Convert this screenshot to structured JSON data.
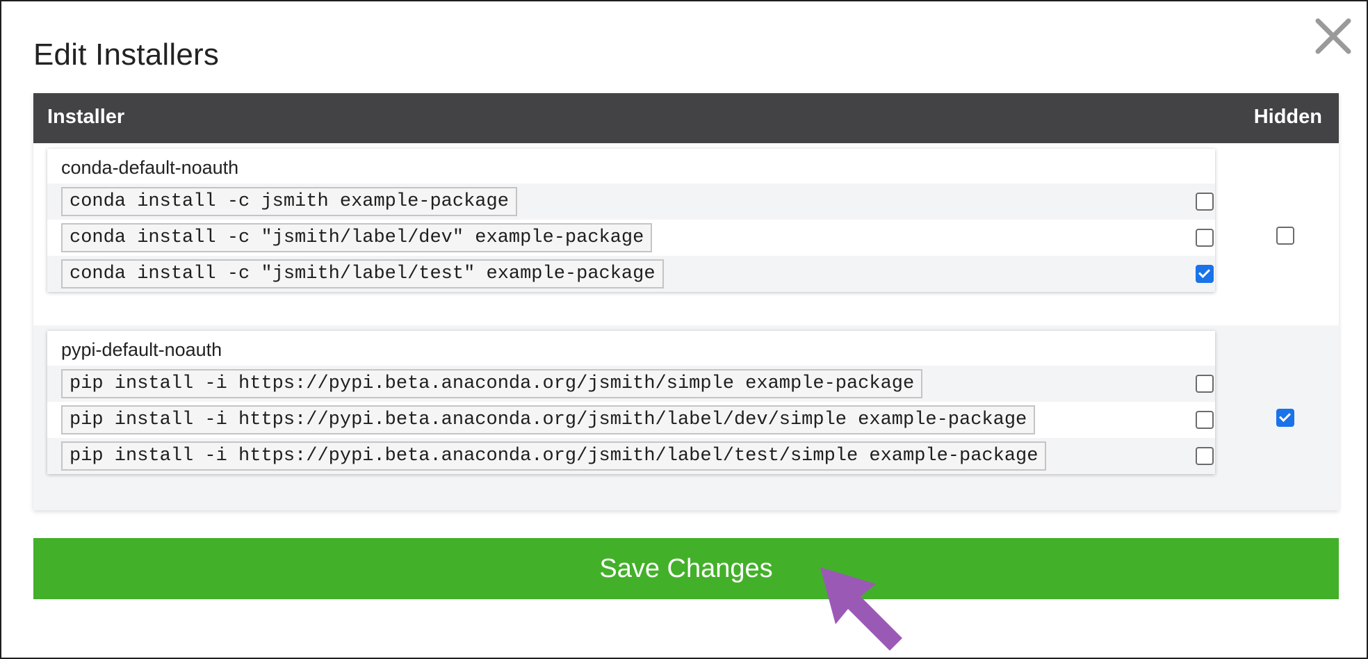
{
  "dialog": {
    "title": "Edit Installers",
    "close_icon": "close-icon"
  },
  "table": {
    "header_installer": "Installer",
    "header_hidden": "Hidden",
    "groups": [
      {
        "name": "conda-default-noauth",
        "hidden": false,
        "commands": [
          {
            "text": "conda install -c jsmith example-package",
            "checked": false
          },
          {
            "text": "conda install -c \"jsmith/label/dev\" example-package",
            "checked": false
          },
          {
            "text": "conda install -c \"jsmith/label/test\" example-package",
            "checked": true
          }
        ]
      },
      {
        "name": "pypi-default-noauth",
        "hidden": true,
        "commands": [
          {
            "text": "pip install -i https://pypi.beta.anaconda.org/jsmith/simple example-package",
            "checked": false
          },
          {
            "text": "pip install -i https://pypi.beta.anaconda.org/jsmith/label/dev/simple example-package",
            "checked": false
          },
          {
            "text": "pip install -i https://pypi.beta.anaconda.org/jsmith/label/test/simple example-package",
            "checked": false
          }
        ]
      }
    ]
  },
  "actions": {
    "save_label": "Save Changes"
  },
  "colors": {
    "header_bg": "#434345",
    "save_bg": "#43b02a",
    "checkbox_checked": "#1a73e8",
    "arrow": "#9b59b6"
  },
  "annotation": {
    "arrow_icon": "pointer-arrow-icon"
  }
}
